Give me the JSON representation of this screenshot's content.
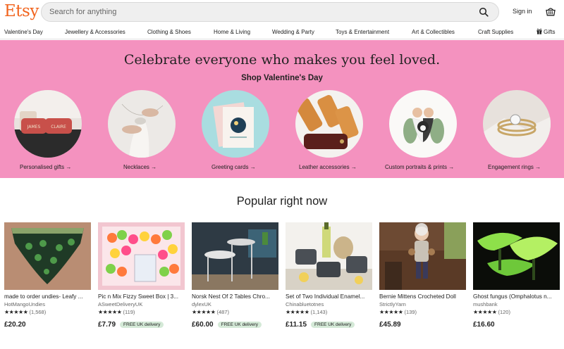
{
  "header": {
    "logo": "Etsy",
    "search_placeholder": "Search for anything",
    "signin_label": "Sign in"
  },
  "nav": {
    "items": [
      "Valentine's Day",
      "Jewellery & Accessories",
      "Clothing & Shoes",
      "Home & Living",
      "Wedding & Party",
      "Toys & Entertainment",
      "Art & Collectibles",
      "Craft Supplies",
      "Gifts"
    ]
  },
  "hero": {
    "title": "Celebrate everyone who makes you feel loved.",
    "subtitle": "Shop Valentine's Day",
    "categories": [
      {
        "label": "Personalised gifts →"
      },
      {
        "label": "Necklaces →"
      },
      {
        "label": "Greeting cards →"
      },
      {
        "label": "Leather accessories →"
      },
      {
        "label": "Custom portraits & prints →"
      },
      {
        "label": "Engagement rings →"
      }
    ],
    "pillow_texts": [
      "JAMES",
      "CLAIRE"
    ],
    "background_color": "#f492bf"
  },
  "popular": {
    "title": "Popular right now",
    "items": [
      {
        "title": "made to order undies- Leafy ...",
        "shop": "HotMangoUndies",
        "stars": "★★★★★",
        "reviews": "(1,568)",
        "price": "£20.20",
        "badge": ""
      },
      {
        "title": "Pic n Mix Fizzy Sweet Box | 3...",
        "shop": "ASweetDeliveryUK",
        "stars": "★★★★★",
        "reviews": "(119)",
        "price": "£7.79",
        "badge": "FREE UK delivery"
      },
      {
        "title": "Norsk Nest Of 2 Tables Chro...",
        "shop": "dylexUK",
        "stars": "★★★★★",
        "reviews": "(487)",
        "price": "£60.00",
        "badge": "FREE UK delivery"
      },
      {
        "title": "Set of Two Individual Enamel...",
        "shop": "Chinabluetotnes",
        "stars": "★★★★★",
        "reviews": "(1,143)",
        "price": "£11.15",
        "badge": "FREE UK delivery"
      },
      {
        "title": "Bernie Mittens Crocheted Doll",
        "shop": "StrictlyYarn",
        "stars": "★★★★★",
        "reviews": "(139)",
        "price": "£45.89",
        "badge": ""
      },
      {
        "title": "Ghost fungus (Omphalotus n...",
        "shop": "mushbank",
        "stars": "★★★★★",
        "reviews": "(120)",
        "price": "£16.60",
        "badge": ""
      }
    ]
  },
  "colors": {
    "brand": "#F1641E",
    "badge_bg": "#d4e9d7"
  }
}
